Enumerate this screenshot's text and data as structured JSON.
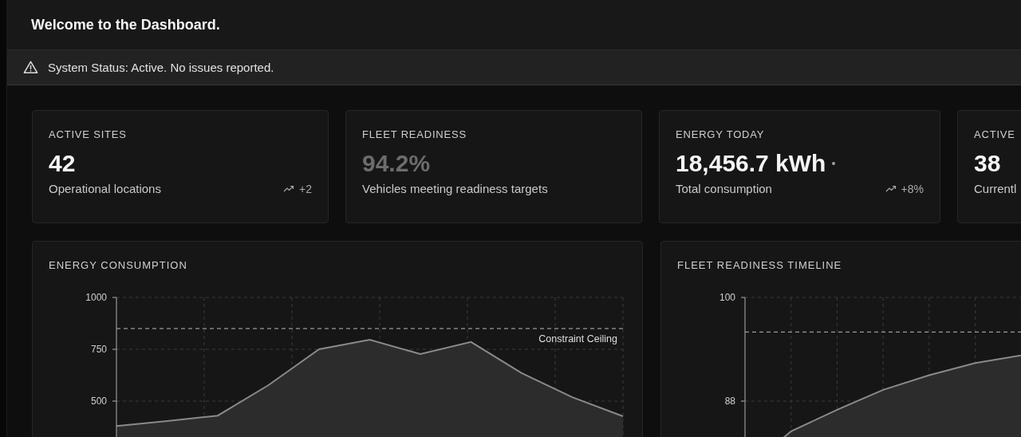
{
  "header": {
    "title": "Welcome to the Dashboard."
  },
  "status_bar": {
    "text": "System Status: Active. No issues reported."
  },
  "stats": [
    {
      "label": "ACTIVE SITES",
      "value": "42",
      "dimmed": false,
      "live": false,
      "caption": "Operational locations",
      "trend": "+2"
    },
    {
      "label": "FLEET READINESS",
      "value": "94.2%",
      "dimmed": true,
      "live": false,
      "caption": "Vehicles meeting readiness targets"
    },
    {
      "label": "ENERGY TODAY",
      "value": "18,456.7 kWh",
      "dimmed": false,
      "live": true,
      "caption": "Total consumption",
      "trend": "+8%"
    },
    {
      "label": "ACTIVE",
      "value": "38",
      "dimmed": false,
      "live": false,
      "caption": "Currentl"
    }
  ],
  "charts": [
    {
      "title": "ENERGY CONSUMPTION",
      "chart_data": {
        "type": "area",
        "categories": [
          null,
          null,
          null,
          null,
          null,
          null,
          null,
          null,
          null,
          null,
          null
        ],
        "ylim": [
          0,
          1000
        ],
        "yticks": [
          500,
          750,
          1000
        ],
        "series": [
          {
            "color": "#8a8a8a",
            "values": [
              380,
              404,
              430,
              577,
              750,
              796,
              727,
              785,
              635,
              519,
              427
            ]
          }
        ],
        "grid": true,
        "ref_lines": [
          {
            "axis": "y",
            "value": 850,
            "color": "#bbbbbb",
            "label": "Constraint Ceiling"
          }
        ]
      }
    },
    {
      "title": "FLEET READINESS TIMELINE",
      "chart_data": {
        "type": "area",
        "categories": [
          null,
          null,
          null,
          null,
          null,
          null,
          null,
          null,
          null,
          null,
          null,
          null
        ],
        "ylim": [
          76,
          100
        ],
        "yticks": [
          88,
          100
        ],
        "series": [
          {
            "color": "#8a8a8a",
            "values": [
              80,
              84.5,
              87,
              89.3,
              91,
              92.4,
              93.3,
              null,
              null,
              null,
              null,
              null
            ]
          }
        ],
        "grid": true,
        "ref_lines": [
          {
            "axis": "y",
            "value": 96,
            "color": "#bbbbbb"
          }
        ]
      }
    }
  ]
}
